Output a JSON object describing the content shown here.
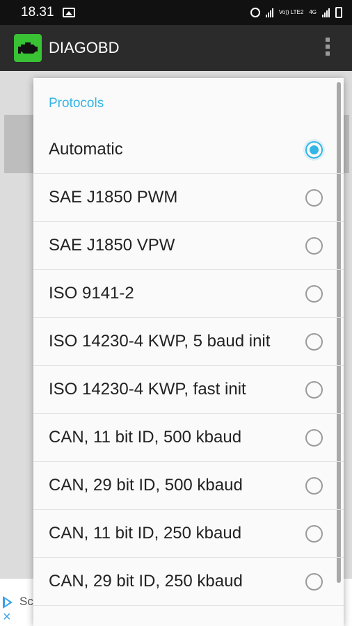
{
  "status_bar": {
    "time": "18.31",
    "network_label": "Vo)) LTE2",
    "network_type": "4G"
  },
  "app_bar": {
    "title": "DIAGOBD",
    "accent_color": "#39c234"
  },
  "dialog": {
    "title": "Protocols",
    "accent_color": "#33b5e5",
    "options": [
      {
        "label": "Automatic",
        "selected": true
      },
      {
        "label": "SAE J1850 PWM",
        "selected": false
      },
      {
        "label": "SAE J1850 VPW",
        "selected": false
      },
      {
        "label": "ISO 9141-2",
        "selected": false
      },
      {
        "label": "ISO 14230-4 KWP, 5 baud init",
        "selected": false
      },
      {
        "label": "ISO 14230-4 KWP, fast init",
        "selected": false
      },
      {
        "label": "CAN, 11 bit ID, 500 kbaud",
        "selected": false
      },
      {
        "label": "CAN, 29 bit ID, 500 kbaud",
        "selected": false
      },
      {
        "label": "CAN, 11 bit ID, 250 kbaud",
        "selected": false
      },
      {
        "label": "CAN, 29 bit ID, 250 kbaud",
        "selected": false
      }
    ]
  },
  "ad": {
    "text": "Sc",
    "close_glyph": "×"
  }
}
